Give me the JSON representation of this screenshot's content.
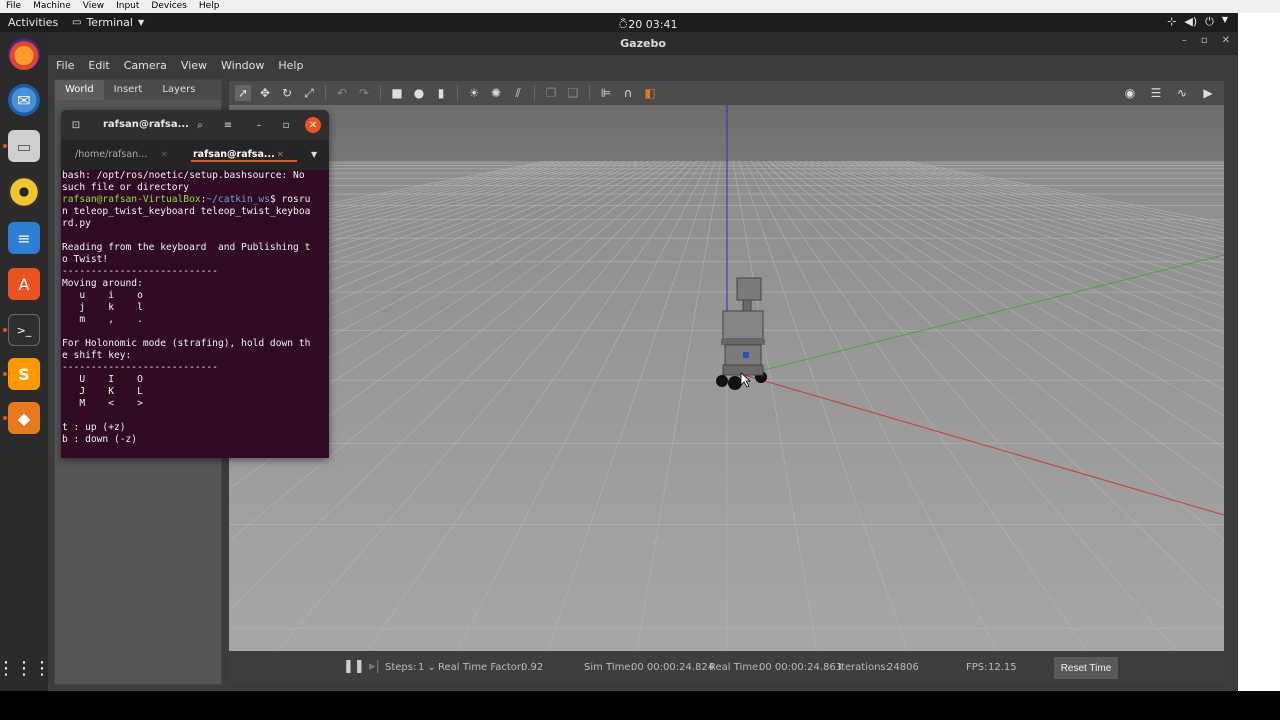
{
  "vbox_menu": [
    "File",
    "Machine",
    "View",
    "Input",
    "Devices",
    "Help"
  ],
  "topbar": {
    "activities": "Activities",
    "app_name": "Terminal",
    "clock": "ঁ20 03:41"
  },
  "gazebo": {
    "title": "Gazebo",
    "menu": [
      "File",
      "Edit",
      "Camera",
      "View",
      "Window",
      "Help"
    ],
    "left_tabs": [
      "World",
      "Insert",
      "Layers"
    ],
    "bottom": {
      "steps_label": "Steps:",
      "steps_value": "1",
      "rtf_label": "Real Time Factor:",
      "rtf_value": "0.92",
      "sim_label": "Sim Time:",
      "sim_value": "00 00:00:24.824",
      "real_label": "Real Time:",
      "real_value": "00 00:00:24.863",
      "iter_label": "Iterations:",
      "iter_value": "24806",
      "fps_label": "FPS:",
      "fps_value": "12.15",
      "reset_label": "Reset Time"
    }
  },
  "terminal": {
    "title": "rafsan@rafsa...",
    "tabs": [
      "/home/rafsan...",
      "rafsan@rafsa..."
    ],
    "lines": {
      "l1": "bash: /opt/ros/noetic/setup.bashsource: No",
      "l2": "such file or directory",
      "p_user": "rafsan@rafsan-VirtualBox",
      "p_path": "~/catkin_ws",
      "p_cmd": "$ rosru",
      "l4": "n teleop_twist_keyboard teleop_twist_keyboa",
      "l5": "rd.py",
      "l6": "",
      "l7": "Reading from the keyboard  and Publishing t",
      "l8": "o Twist!",
      "l9": "---------------------------",
      "l10": "Moving around:",
      "l11": "   u    i    o",
      "l12": "   j    k    l",
      "l13": "   m    ,    .",
      "l14": "",
      "l15": "For Holonomic mode (strafing), hold down th",
      "l16": "e shift key:",
      "l17": "---------------------------",
      "l18": "   U    I    O",
      "l19": "   J    K    L",
      "l20": "   M    <    >",
      "l21": "",
      "l22": "t : up (+z)",
      "l23": "b : down (-z)"
    }
  },
  "colors": {
    "terminal_bg": "#300a24",
    "accent": "#e95420",
    "x_axis": "#c04040",
    "y_axis": "#3c9c3c",
    "z_axis": "#3030c0"
  }
}
